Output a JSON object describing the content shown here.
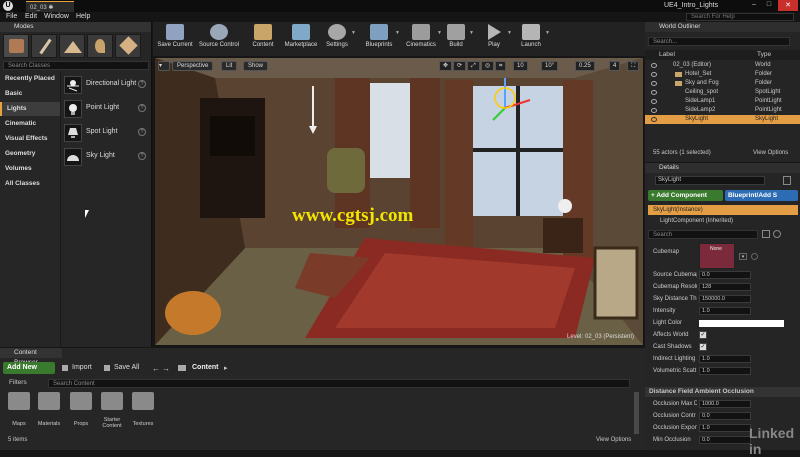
{
  "window": {
    "tab_title": "02_03 ✱",
    "app_title": "UE4_Intro_Lights",
    "search_help_placeholder": "Search For Help"
  },
  "menu": [
    "File",
    "Edit",
    "Window",
    "Help"
  ],
  "modes": {
    "tab_label": "Modes",
    "search_placeholder": "Search Classes",
    "categories": [
      "Recently Placed",
      "Basic",
      "Lights",
      "Cinematic",
      "Visual Effects",
      "Geometry",
      "Volumes",
      "All Classes"
    ],
    "selected_category": "Lights",
    "items": [
      "Directional Light",
      "Point Light",
      "Spot Light",
      "Sky Light"
    ]
  },
  "toolbar": [
    {
      "label": "Save Current",
      "icon": "save-icon",
      "color": "#8fa3c0"
    },
    {
      "label": "Source Control",
      "icon": "source-control-icon",
      "color": "#9aa7b8"
    },
    {
      "label": "Content",
      "icon": "content-icon",
      "color": "#c9a56a"
    },
    {
      "label": "Marketplace",
      "icon": "marketplace-icon",
      "color": "#7fa8c9"
    },
    {
      "label": "Settings",
      "icon": "settings-icon",
      "color": "#a7a7a7"
    },
    {
      "label": "Blueprints",
      "icon": "blueprints-icon",
      "color": "#7f9fc0"
    },
    {
      "label": "Cinematics",
      "icon": "cinematics-icon",
      "color": "#9c9c9c"
    },
    {
      "label": "Build",
      "icon": "build-icon",
      "color": "#a0a0a0"
    },
    {
      "label": "Play",
      "icon": "play-icon",
      "color": "#b5b5b5"
    },
    {
      "label": "Launch",
      "icon": "launch-icon",
      "color": "#b5b5b5"
    }
  ],
  "viewport": {
    "perspective_label": "Perspective",
    "lit_label": "Lit",
    "show_label": "Show",
    "grid_snap": "10",
    "rot_snap": "10°",
    "scale_snap": "0.25",
    "camera_speed": "4",
    "level_label": "Level:",
    "level_name": "02_03 (Persistent)",
    "watermark": "www.cgtsj.com"
  },
  "outliner": {
    "tab_label": "World Outliner",
    "search_placeholder": "Search...",
    "col_label": "Label",
    "col_type": "Type",
    "rows": [
      {
        "label": "02_03 (Editor)",
        "type": "World"
      },
      {
        "label": "Hotel_Set",
        "type": "Folder"
      },
      {
        "label": "Sky and Fog",
        "type": "Folder"
      },
      {
        "label": "Ceiling_spot",
        "type": "SpotLight"
      },
      {
        "label": "SideLamp1",
        "type": "PointLight"
      },
      {
        "label": "SideLamp2",
        "type": "PointLight"
      },
      {
        "label": "SkyLight",
        "type": "SkyLight"
      }
    ],
    "selected_row": "SkyLight",
    "status": "55 actors (1 selected)",
    "view_options": "View Options"
  },
  "details": {
    "tab_label": "Details",
    "name_value": "SkyLight",
    "add_component": "+ Add Component",
    "blueprint_add": "Blueprint/Add S",
    "search_placeholder": "Search",
    "instance_row": "SkyLight(Instance)",
    "component_row": "LightComponent (Inherited)",
    "cubemap_label": "Cubemap",
    "cubemap_value": "None",
    "props": [
      {
        "label": "Source Cubemap",
        "value": "0.0"
      },
      {
        "label": "Cubemap Resolu",
        "value": "128"
      },
      {
        "label": "Sky Distance Th",
        "value": "150000.0"
      },
      {
        "label": "Intensity",
        "value": "1.0"
      }
    ],
    "light_color_label": "Light Color",
    "checks": [
      {
        "label": "Affects World",
        "checked": "✓"
      },
      {
        "label": "Cast Shadows",
        "checked": "✓"
      }
    ],
    "props2": [
      {
        "label": "Indirect Lighting",
        "value": "1.0"
      },
      {
        "label": "Volumetric Scatt",
        "value": "1.0"
      }
    ],
    "section_dfao": "Distance Field Ambient Occlusion",
    "props3": [
      {
        "label": "Occlusion Max D",
        "value": "1000.0"
      },
      {
        "label": "Occlusion Contr",
        "value": "0.0"
      },
      {
        "label": "Occlusion Expon",
        "value": "1.0"
      },
      {
        "label": "Min Occlusion",
        "value": "0.0"
      }
    ],
    "brand_watermark": "Linked in"
  },
  "content_browser": {
    "tab_label": "Content Browser",
    "add_new": "Add New",
    "import": "Import",
    "save_all": "Save All",
    "path_content": "Content",
    "filters": "Filters",
    "search_placeholder": "Search Content",
    "folders": [
      "Maps",
      "Materials",
      "Props",
      "Starter Content",
      "Textures"
    ],
    "status": "5 items",
    "view_options": "View Options"
  }
}
